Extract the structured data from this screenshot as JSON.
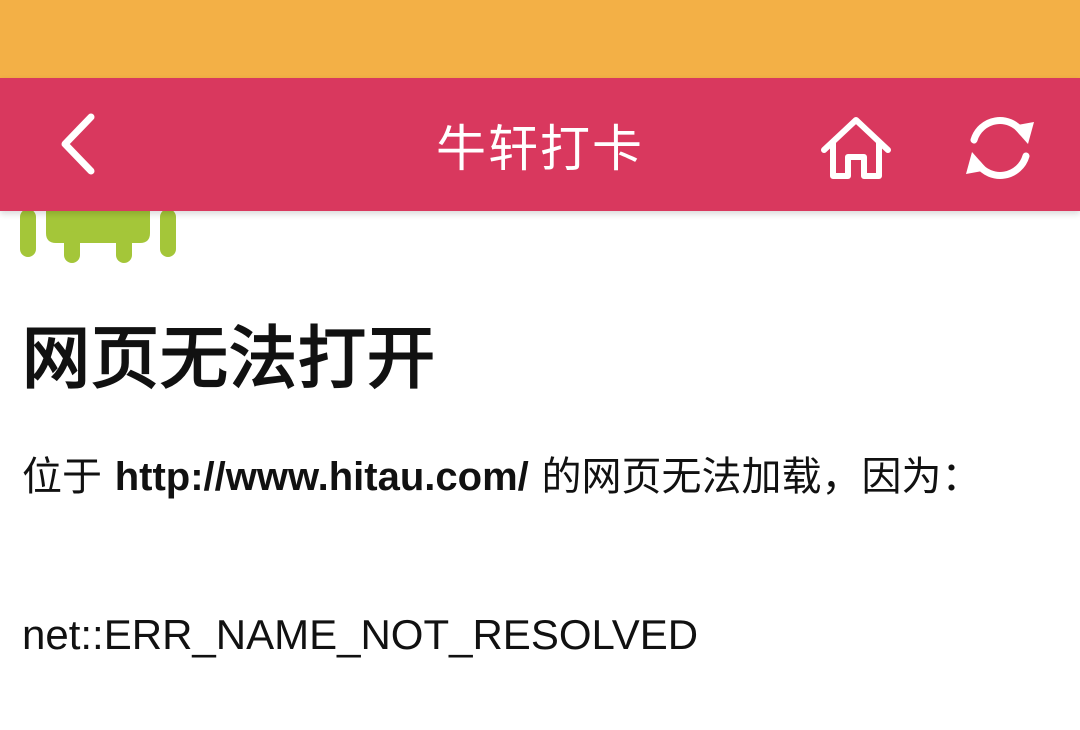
{
  "colors": {
    "status_bar": "#f3b046",
    "app_bar": "#d9385e",
    "app_bar_text": "#ffffff",
    "android_green": "#a4c639",
    "body_text": "#111111"
  },
  "app_bar": {
    "title": "牛轩打卡",
    "icons": {
      "back": "chevron-left-icon",
      "home": "home-icon",
      "refresh": "refresh-icon"
    }
  },
  "error_page": {
    "icon": "android-robot-icon",
    "heading": "网页无法打开",
    "desc_prefix": "位于 ",
    "url": "http://www.hitau.com/",
    "desc_suffix": " 的网页无法加载，因为：",
    "error_code": "net::ERR_NAME_NOT_RESOLVED"
  }
}
